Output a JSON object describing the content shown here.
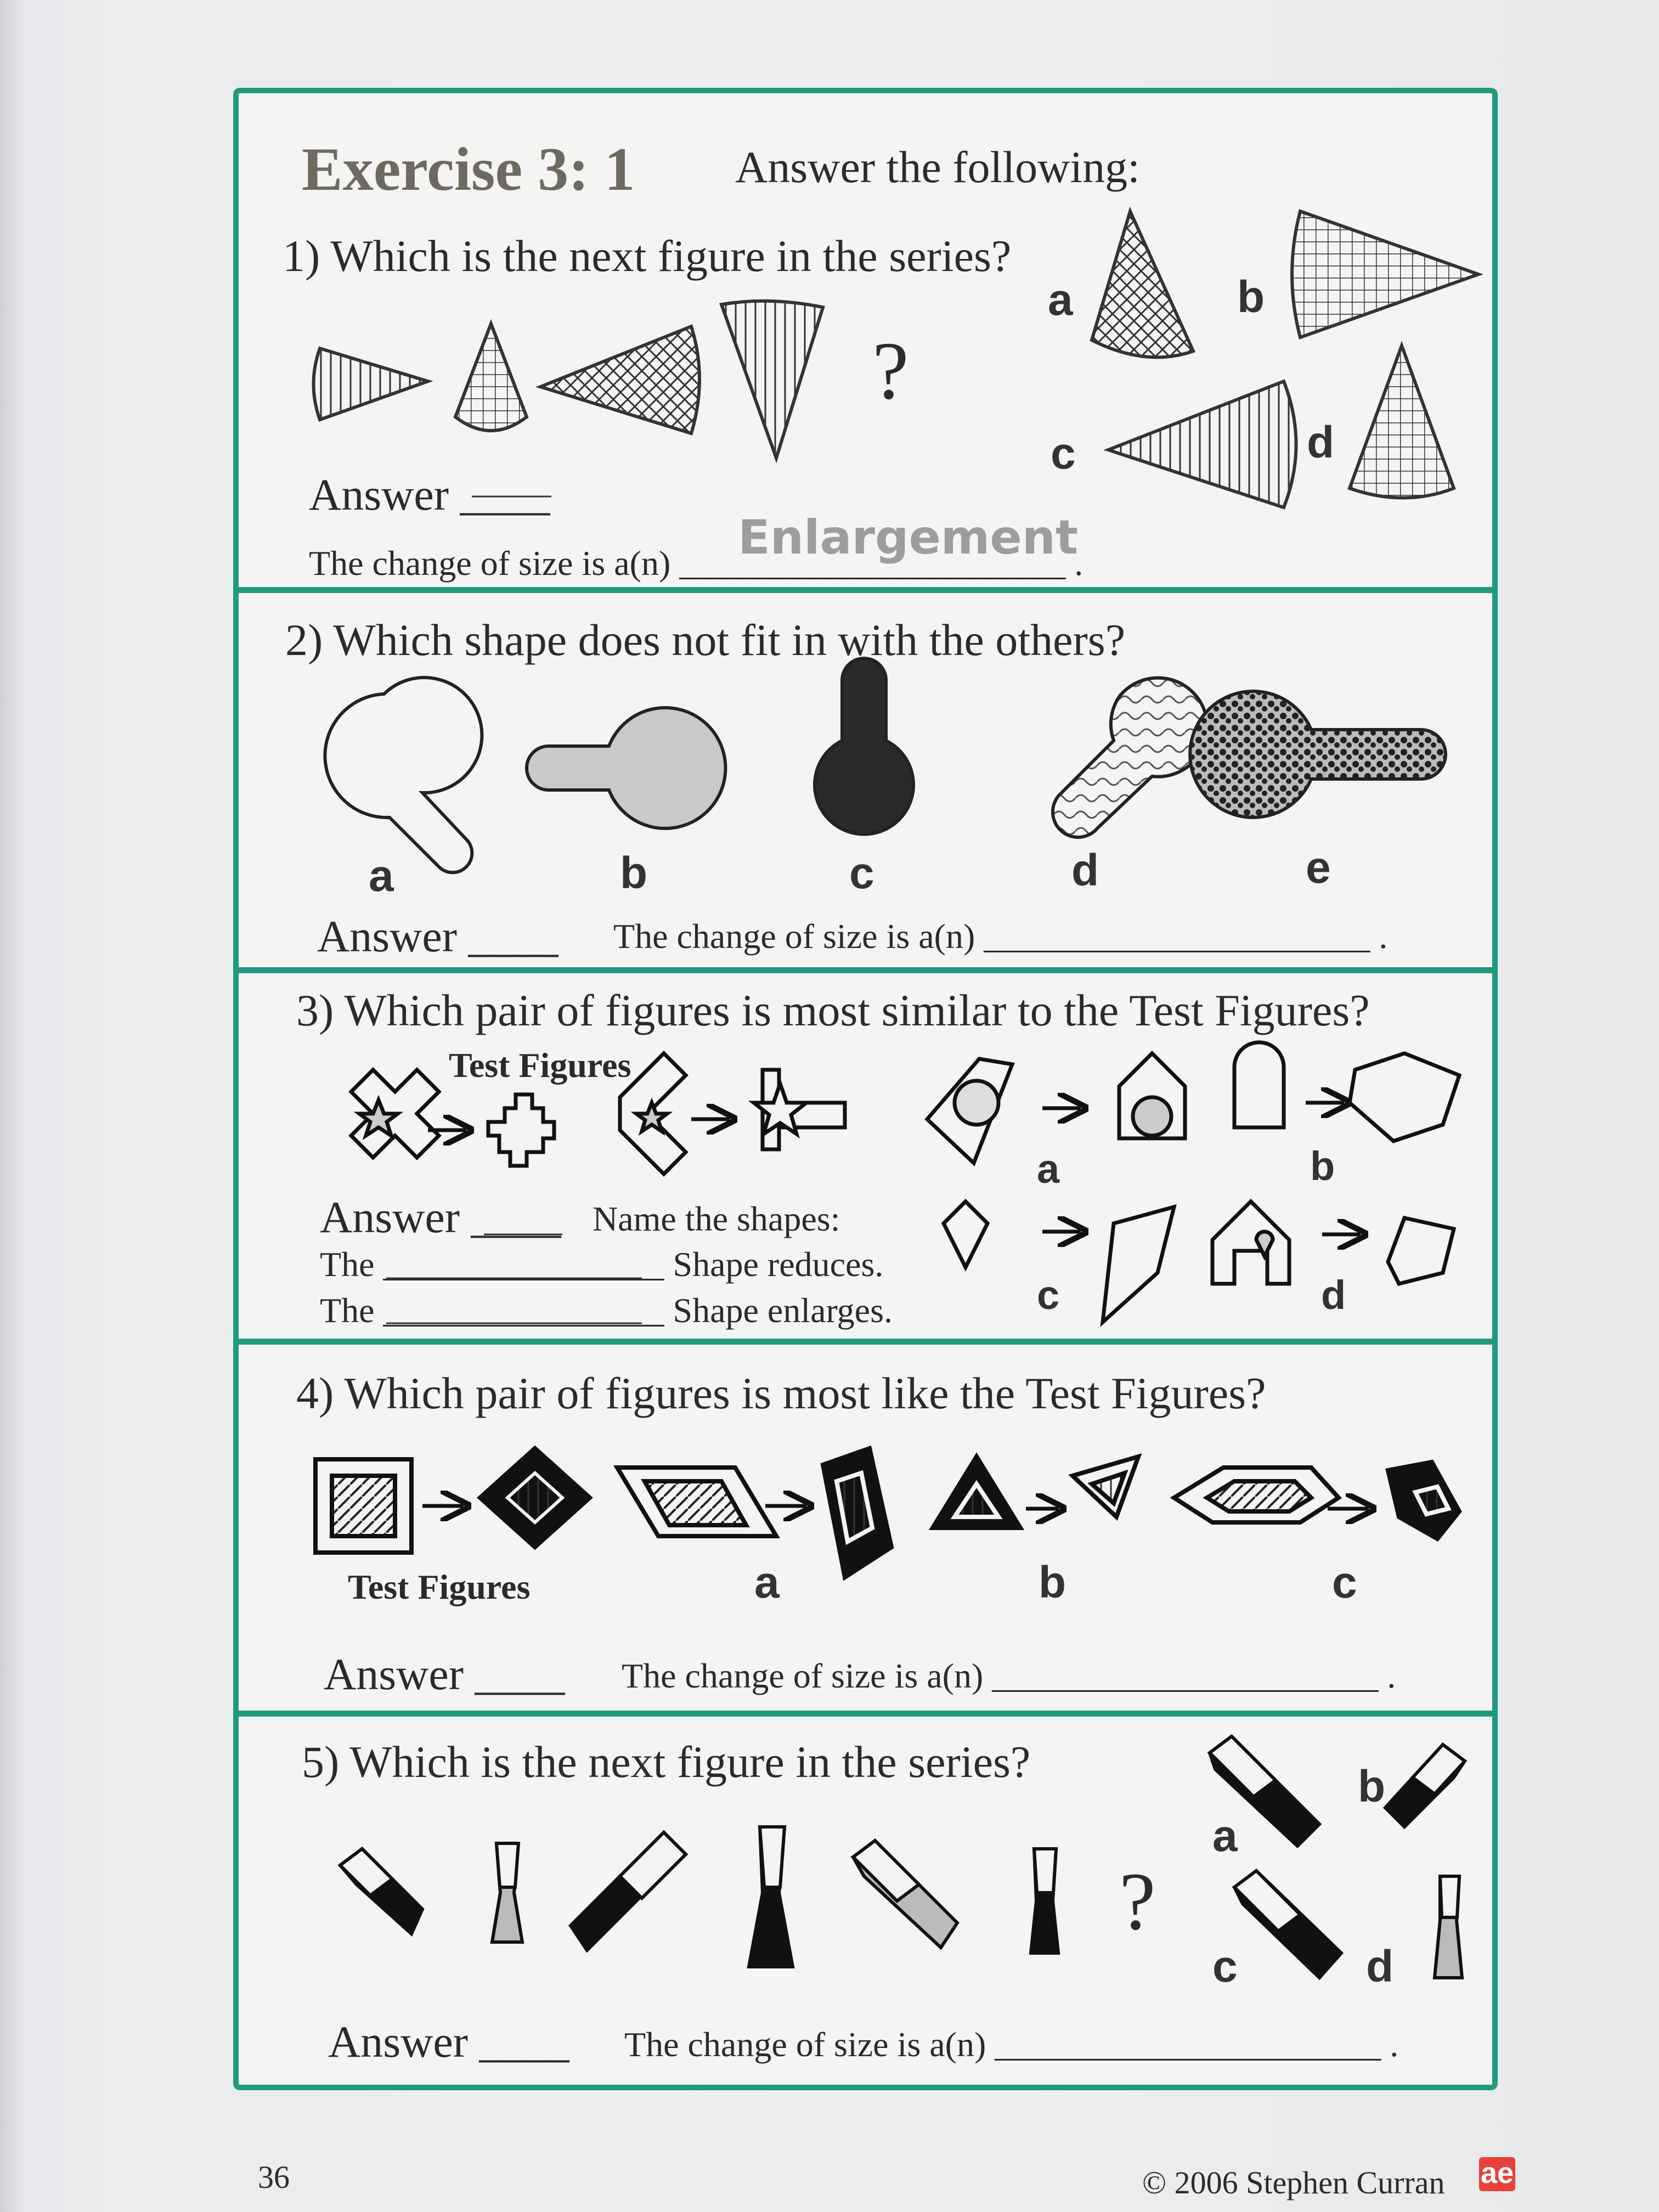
{
  "exercise": {
    "title": "Exercise 3: 1",
    "instruction": "Answer the following:"
  },
  "q1": {
    "question": "1) Which is the next figure in the series?",
    "question_mark": "?",
    "options": [
      "a",
      "b",
      "c",
      "d"
    ],
    "answer_label": "Answer ____",
    "size_prompt": "The change of size is a(n) ______________________ .",
    "handwritten": "Enlargement"
  },
  "q2": {
    "question": "2) Which shape does not fit in with the others?",
    "options": [
      "a",
      "b",
      "c",
      "d",
      "e"
    ],
    "answer_label": "Answer ____",
    "size_prompt": "The change of size is a(n) ______________________ ."
  },
  "q3": {
    "question": "3) Which pair of figures is most similar to the Test Figures?",
    "test_figures": "Test Figures",
    "options": [
      "a",
      "b",
      "c",
      "d"
    ],
    "answer_label": "Answer ____",
    "name_prompt": "Name the shapes:",
    "line1": "The ________________ Shape reduces.",
    "line2": "The ________________ Shape enlarges."
  },
  "q4": {
    "question": "4) Which pair of figures is most like the Test Figures?",
    "test_figures": "Test Figures",
    "options": [
      "a",
      "b",
      "c"
    ],
    "answer_label": "Answer ____",
    "size_prompt": "The change of size is a(n) ______________________ ."
  },
  "q5": {
    "question": "5) Which is the next figure in the series?",
    "question_mark": "?",
    "options": [
      "a",
      "b",
      "c",
      "d"
    ],
    "answer_label": "Answer ____",
    "size_prompt": "The change of size is a(n) ______________________ ."
  },
  "footer": {
    "page_number": "36",
    "copyright": "© 2006 Stephen Curran",
    "logo": "ae"
  },
  "colors": {
    "frame": "#1f9a7e",
    "ink": "#2b2b2b",
    "logo": "#e8413a"
  }
}
